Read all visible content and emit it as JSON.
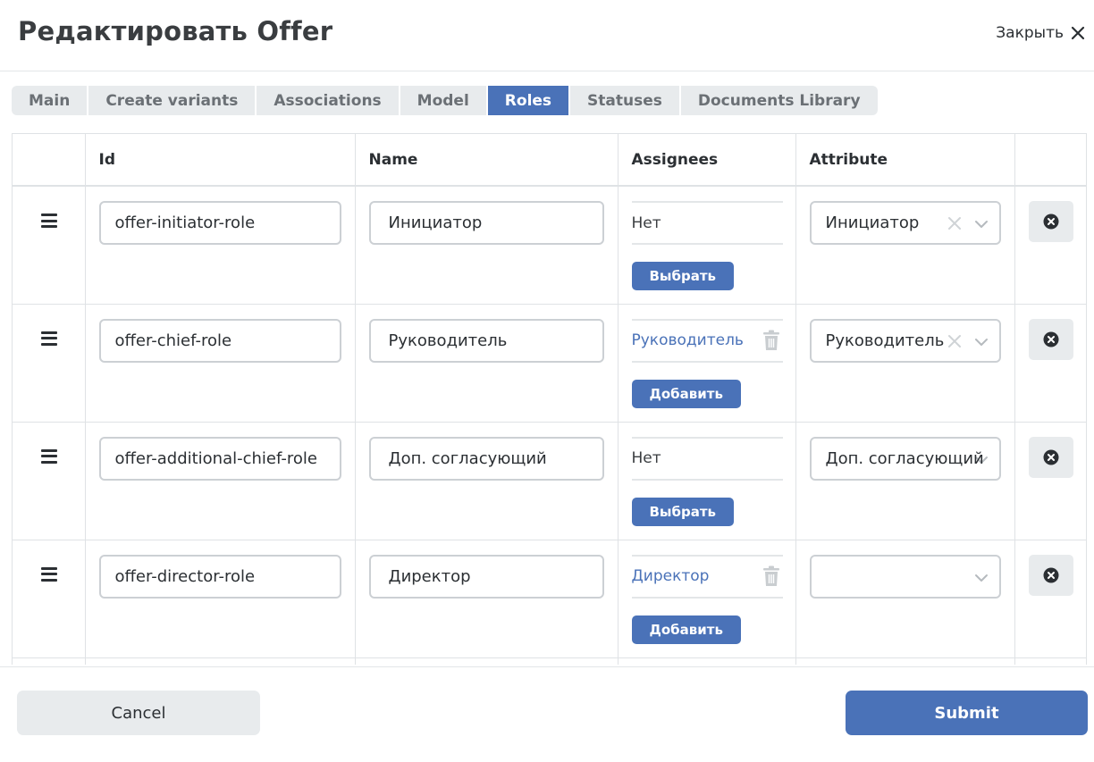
{
  "modal": {
    "title": "Редактировать Offer",
    "close_label": "Закрыть"
  },
  "tabs": [
    {
      "label": "Main",
      "active": false
    },
    {
      "label": "Create variants",
      "active": false
    },
    {
      "label": "Associations",
      "active": false
    },
    {
      "label": "Model",
      "active": false
    },
    {
      "label": "Roles",
      "active": true
    },
    {
      "label": "Statuses",
      "active": false
    },
    {
      "label": "Documents Library",
      "active": false
    }
  ],
  "table": {
    "headers": {
      "drag": "",
      "id": "Id",
      "name": "Name",
      "assignees": "Assignees",
      "attribute": "Attribute",
      "actions": ""
    },
    "rows": [
      {
        "id": "offer-initiator-role",
        "name": "Инициатор",
        "assignee": "Нет",
        "assignee_is_link": false,
        "assignee_button": "Выбрать",
        "attribute": "Инициатор",
        "attribute_clearable": true
      },
      {
        "id": "offer-chief-role",
        "name": "Руководитель",
        "assignee": "Руководитель",
        "assignee_is_link": true,
        "assignee_button": "Добавить",
        "attribute": "Руководитель",
        "attribute_clearable": true
      },
      {
        "id": "offer-additional-chief-role",
        "name": "Доп. согласующий",
        "assignee": "Нет",
        "assignee_is_link": false,
        "assignee_button": "Выбрать",
        "attribute": "Доп. согласующий",
        "attribute_clearable": false
      },
      {
        "id": "offer-director-role",
        "name": "Директор",
        "assignee": "Директор",
        "assignee_is_link": true,
        "assignee_button": "Добавить",
        "attribute": "",
        "attribute_clearable": false
      }
    ]
  },
  "footer": {
    "cancel_label": "Cancel",
    "submit_label": "Submit"
  },
  "colors": {
    "accent": "#4a72b8",
    "tab_inactive_bg": "#e8ebed",
    "border": "#dfe2e5"
  },
  "icons": {
    "close": "close-x-icon",
    "drag": "drag-handle-icon",
    "trash": "trash-icon",
    "clear": "clear-x-icon",
    "chevron": "chevron-down-icon",
    "remove": "remove-circle-x-icon"
  }
}
